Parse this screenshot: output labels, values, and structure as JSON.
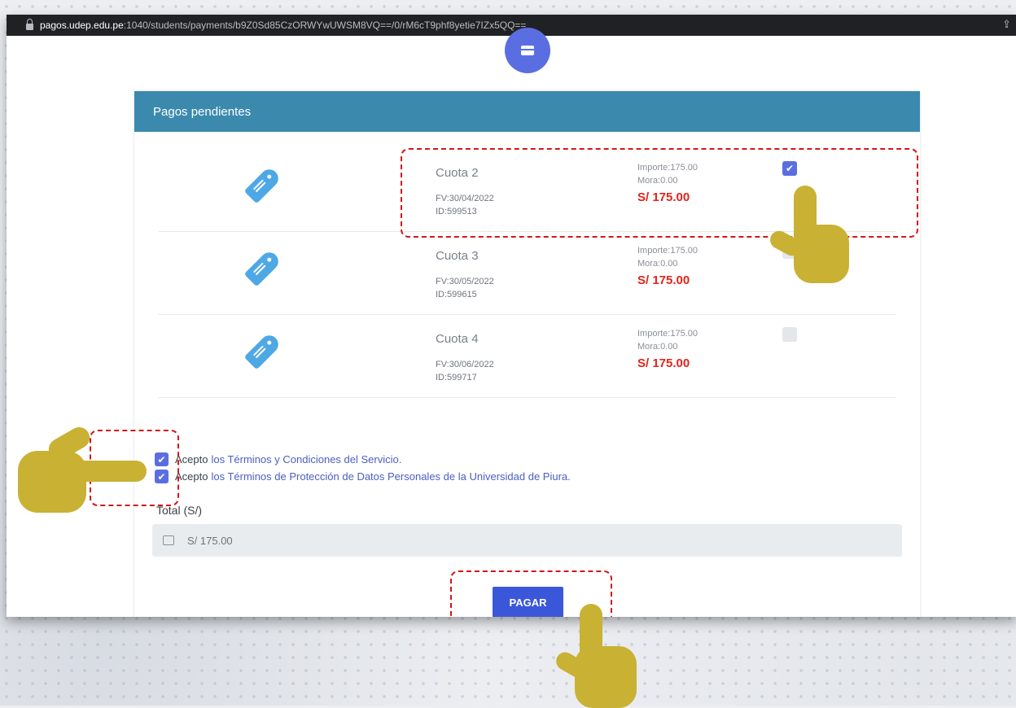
{
  "browser": {
    "domain": "pagos.udep.edu.pe",
    "path": ":1040/students/payments/b9Z0Sd85CzORWYwUWSM8VQ==/0/rM6cT9phf8yetie7IZx5QQ=="
  },
  "panel": {
    "title": "Pagos pendientes"
  },
  "items": [
    {
      "label": "Cuota 2",
      "fv": "FV:30/04/2022",
      "id": "ID:599513",
      "importe": "Importe:175.00",
      "mora": "Mora:0.00",
      "amount": "S/ 175.00",
      "checked": true
    },
    {
      "label": "Cuota 3",
      "fv": "FV:30/05/2022",
      "id": "ID:599615",
      "importe": "Importe:175.00",
      "mora": "Mora:0.00",
      "amount": "S/ 175.00",
      "checked": false
    },
    {
      "label": "Cuota 4",
      "fv": "FV:30/06/2022",
      "id": "ID:599717",
      "importe": "Importe:175.00",
      "mora": "Mora:0.00",
      "amount": "S/ 175.00",
      "checked": false
    }
  ],
  "terms": {
    "accept_prefix": "Acepto",
    "terms_link": "los Términos y Condiciones del Servicio.",
    "data_link": "los Términos de Protección de Datos Personales de la Universidad de Piura."
  },
  "total": {
    "label": "Total (S/)",
    "value": "S/ 175.00"
  },
  "actions": {
    "pay_label": "PAGAR"
  },
  "colors": {
    "panel_header": "#3b8aae",
    "accent": "#5b6ee1",
    "amount_red": "#e0241b",
    "pay_button": "#3b57d9",
    "highlight": "#d4161a",
    "hand": "#c9b134"
  },
  "icons": [
    "lock-icon",
    "share-icon",
    "credit-card-icon",
    "price-tag-icon",
    "money-icon",
    "pointing-hand-icon"
  ]
}
